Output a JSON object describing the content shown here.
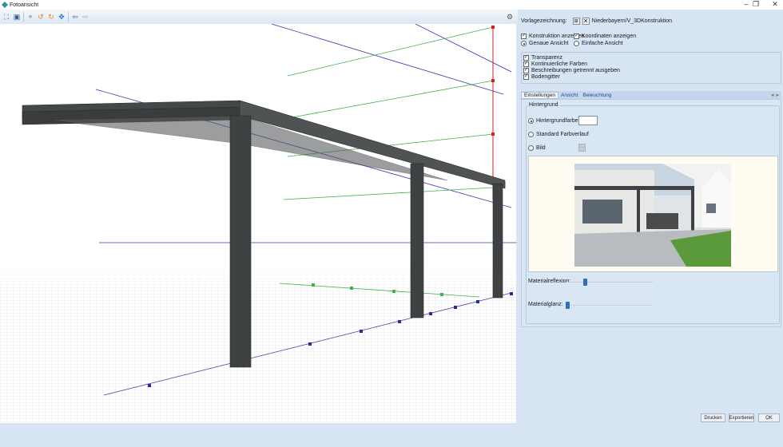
{
  "window": {
    "title": "Fotoansicht",
    "minimize": "–",
    "maximize": "❐",
    "close": "✕"
  },
  "toolbar": {
    "icons": [
      "zoom-fit-icon",
      "render-icon",
      "measure-icon",
      "rotate-left-icon",
      "rotate-right-icon",
      "move-icon",
      "arrow-left-icon",
      "arrow-right-icon"
    ],
    "right_icon": "settings-icon"
  },
  "panel": {
    "template_label": "Vorlagezeichnung:",
    "template_value": "Niederbayern/V_3DKonstruktion",
    "show_construction": {
      "label": "Konstruktion anzeigen",
      "checked": true
    },
    "show_coordinates": {
      "label": "Koordinaten anzeigen",
      "checked": true
    },
    "exact_view": {
      "label": "Genaue Ansicht",
      "selected": true
    },
    "simple_view": {
      "label": "Einfache Ansicht",
      "selected": false
    },
    "options": [
      {
        "label": "Transparenz",
        "checked": true
      },
      {
        "label": "Kontinuierliche Farben",
        "checked": true
      },
      {
        "label": "Beschreibungen getrennt ausgeben",
        "checked": true
      },
      {
        "label": "Bodengitter",
        "checked": true
      }
    ],
    "tabs": [
      {
        "label": "Einstellungen",
        "active": true
      },
      {
        "label": "Ansicht"
      },
      {
        "label": "Beleuchtung"
      }
    ],
    "tab_nav": {
      "prev": "◂",
      "next": "▸"
    },
    "background_group": "Hintergrund",
    "bg_color": {
      "label": "Hintergrundfarbe",
      "selected": true,
      "color": "#ffffff"
    },
    "bg_gradient": {
      "label": "Standard Farbverlauf",
      "selected": false
    },
    "bg_image": {
      "label": "Bild",
      "selected": false,
      "browse": "..."
    },
    "material_reflection": {
      "label": "Materialreflexion:",
      "value_percent": 20
    },
    "material_gloss": {
      "label": "Materialglanz:",
      "value_percent": 0
    }
  },
  "buttons": {
    "print": "Drucken",
    "export": "Exportieren",
    "ok": "OK"
  }
}
